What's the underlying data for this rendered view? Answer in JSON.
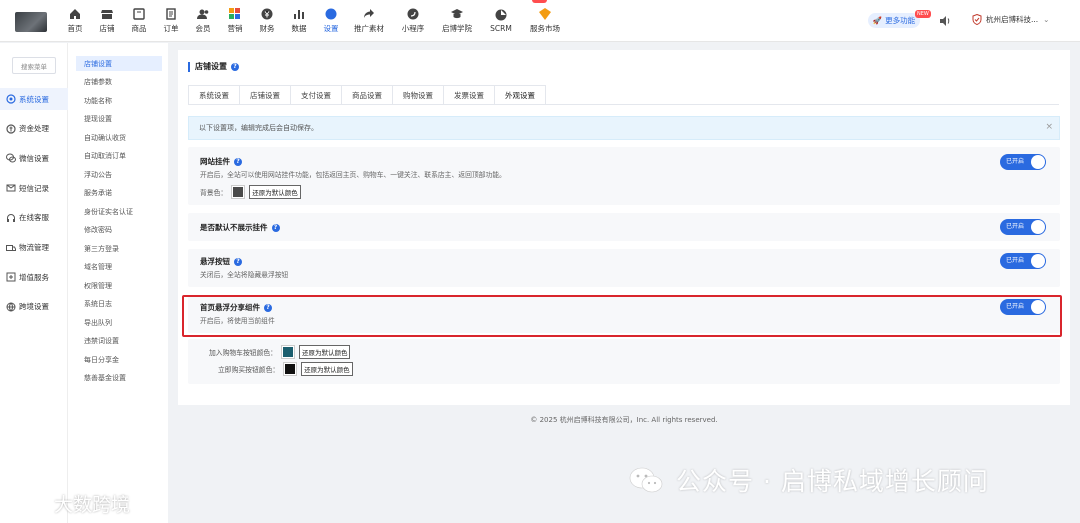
{
  "nav": {
    "items": [
      {
        "label": "首页",
        "icon": "home-icon"
      },
      {
        "label": "店铺",
        "icon": "store-icon"
      },
      {
        "label": "商品",
        "icon": "goods-icon"
      },
      {
        "label": "订单",
        "icon": "order-icon"
      },
      {
        "label": "会员",
        "icon": "member-icon"
      },
      {
        "label": "营销",
        "icon": "marketing-icon"
      },
      {
        "label": "财务",
        "icon": "finance-icon"
      },
      {
        "label": "数据",
        "icon": "data-icon"
      },
      {
        "label": "设置",
        "icon": "settings-icon",
        "active": true
      },
      {
        "label": "推广素材",
        "icon": "share-icon"
      },
      {
        "label": "小程序",
        "icon": "miniapp-icon"
      },
      {
        "label": "启博学院",
        "icon": "academy-icon"
      },
      {
        "label": "SCRM",
        "icon": "scrm-icon"
      },
      {
        "label": "服务市场",
        "icon": "market-icon",
        "hot": "HOT"
      }
    ],
    "more_label": "更多功能",
    "new_tag": "NEW",
    "store_name": "杭州启博科技..."
  },
  "sidebar": {
    "search_placeholder": "搜索菜单",
    "items": [
      {
        "label": "系统设置",
        "icon": "gear-icon",
        "active": true
      },
      {
        "label": "资金处理",
        "icon": "money-icon"
      },
      {
        "label": "微信设置",
        "icon": "wechat-icon"
      },
      {
        "label": "短信记录",
        "icon": "sms-icon"
      },
      {
        "label": "在线客服",
        "icon": "headset-icon"
      },
      {
        "label": "物流管理",
        "icon": "truck-icon"
      },
      {
        "label": "增值服务",
        "icon": "plus-service-icon"
      },
      {
        "label": "跨境设置",
        "icon": "globe-icon"
      }
    ]
  },
  "subnav": {
    "items": [
      {
        "label": "店铺设置",
        "active": true
      },
      {
        "label": "店铺参数"
      },
      {
        "label": "功能名称"
      },
      {
        "label": "提现设置"
      },
      {
        "label": "自动确认收货"
      },
      {
        "label": "自动取消订单"
      },
      {
        "label": "浮动公告"
      },
      {
        "label": "服务承诺"
      },
      {
        "label": "身份证实名认证"
      },
      {
        "label": "修改密码"
      },
      {
        "label": "第三方登录"
      },
      {
        "label": "域名管理"
      },
      {
        "label": "权限管理"
      },
      {
        "label": "系统日志"
      },
      {
        "label": "导出队列"
      },
      {
        "label": "违禁词设置"
      },
      {
        "label": "每日分享金"
      },
      {
        "label": "慈善基金设置"
      }
    ]
  },
  "main": {
    "title": "店铺设置",
    "tabs": [
      "系统设置",
      "店铺设置",
      "支付设置",
      "商品设置",
      "购物设置",
      "发票设置",
      "外观设置"
    ],
    "active_tab": 6,
    "notice": "以下设置项，编辑完成后会自动保存。",
    "toggle_label": "已开启",
    "reset_label": "还原为默认颜色",
    "blocks": {
      "site_plugin": {
        "title": "网站挂件",
        "desc": "开启后，全站可以使用网站挂件功能，包括返回主页、购物车、一键关注、联系店主、返回顶部功能。",
        "bg_label": "背景色：",
        "bg_color": "#4a4a4a"
      },
      "hide_default": {
        "title": "是否默认不展示挂件"
      },
      "float_button": {
        "title": "悬浮按钮",
        "desc": "关闭后，全站将隐藏悬浮按钮"
      },
      "share_widget": {
        "title": "首页悬浮分享组件",
        "desc": "开启后，将使用当前组件"
      },
      "colors": {
        "cart_label": "加入购物车按钮颜色：",
        "cart_color": "#1b5e6e",
        "buy_label": "立即购买按钮颜色：",
        "buy_color": "#111111"
      }
    }
  },
  "footer": "© 2025 杭州启博科技有限公司，Inc. All rights reserved.",
  "watermark": {
    "right": "公众号 · 启博私域增长顾问",
    "left": "大数跨境"
  },
  "colors": {
    "accent": "#2a6ae0",
    "highlight": "#d9252c"
  }
}
